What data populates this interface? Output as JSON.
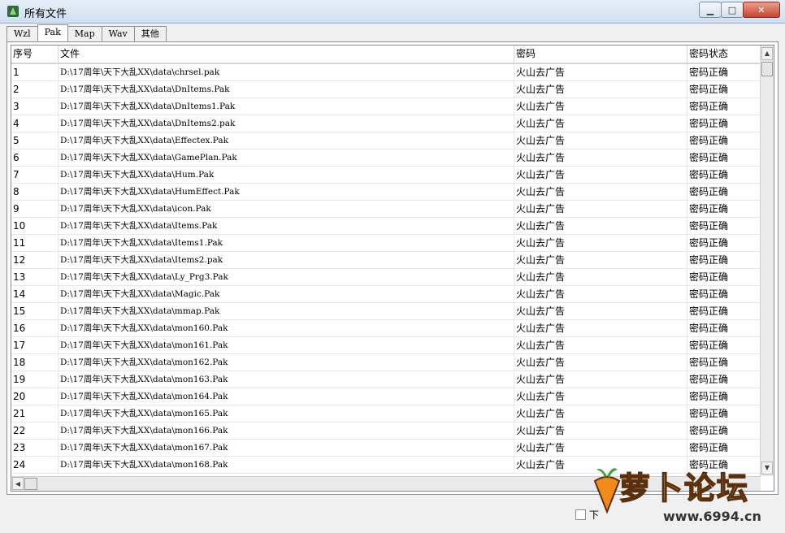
{
  "window": {
    "title": "所有文件"
  },
  "tabs": [
    {
      "label": "Wzl"
    },
    {
      "label": "Pak"
    },
    {
      "label": "Map"
    },
    {
      "label": "Wav"
    },
    {
      "label": "其他"
    }
  ],
  "columns": [
    "序号",
    "文件",
    "密码",
    "密码状态"
  ],
  "rows": [
    {
      "n": "1",
      "file": "D:\\17周年\\天下大乱XX\\data\\chrsel.pak",
      "pw": "火山去广告",
      "status": "密码正确"
    },
    {
      "n": "2",
      "file": "D:\\17周年\\天下大乱XX\\data\\DnItems.Pak",
      "pw": "火山去广告",
      "status": "密码正确"
    },
    {
      "n": "3",
      "file": "D:\\17周年\\天下大乱XX\\data\\DnItems1.Pak",
      "pw": "火山去广告",
      "status": "密码正确"
    },
    {
      "n": "4",
      "file": "D:\\17周年\\天下大乱XX\\data\\DnItems2.pak",
      "pw": "火山去广告",
      "status": "密码正确"
    },
    {
      "n": "5",
      "file": "D:\\17周年\\天下大乱XX\\data\\Effectex.Pak",
      "pw": "火山去广告",
      "status": "密码正确"
    },
    {
      "n": "6",
      "file": "D:\\17周年\\天下大乱XX\\data\\GamePlan.Pak",
      "pw": "火山去广告",
      "status": "密码正确"
    },
    {
      "n": "7",
      "file": "D:\\17周年\\天下大乱XX\\data\\Hum.Pak",
      "pw": "火山去广告",
      "status": "密码正确"
    },
    {
      "n": "8",
      "file": "D:\\17周年\\天下大乱XX\\data\\HumEffect.Pak",
      "pw": "火山去广告",
      "status": "密码正确"
    },
    {
      "n": "9",
      "file": "D:\\17周年\\天下大乱XX\\data\\icon.Pak",
      "pw": "火山去广告",
      "status": "密码正确"
    },
    {
      "n": "10",
      "file": "D:\\17周年\\天下大乱XX\\data\\Items.Pak",
      "pw": "火山去广告",
      "status": "密码正确"
    },
    {
      "n": "11",
      "file": "D:\\17周年\\天下大乱XX\\data\\Items1.Pak",
      "pw": "火山去广告",
      "status": "密码正确"
    },
    {
      "n": "12",
      "file": "D:\\17周年\\天下大乱XX\\data\\Items2.pak",
      "pw": "火山去广告",
      "status": "密码正确"
    },
    {
      "n": "13",
      "file": "D:\\17周年\\天下大乱XX\\data\\Ly_Prg3.Pak",
      "pw": "火山去广告",
      "status": "密码正确"
    },
    {
      "n": "14",
      "file": "D:\\17周年\\天下大乱XX\\data\\Magic.Pak",
      "pw": "火山去广告",
      "status": "密码正确"
    },
    {
      "n": "15",
      "file": "D:\\17周年\\天下大乱XX\\data\\mmap.Pak",
      "pw": "火山去广告",
      "status": "密码正确"
    },
    {
      "n": "16",
      "file": "D:\\17周年\\天下大乱XX\\data\\mon160.Pak",
      "pw": "火山去广告",
      "status": "密码正确"
    },
    {
      "n": "17",
      "file": "D:\\17周年\\天下大乱XX\\data\\mon161.Pak",
      "pw": "火山去广告",
      "status": "密码正确"
    },
    {
      "n": "18",
      "file": "D:\\17周年\\天下大乱XX\\data\\mon162.Pak",
      "pw": "火山去广告",
      "status": "密码正确"
    },
    {
      "n": "19",
      "file": "D:\\17周年\\天下大乱XX\\data\\mon163.Pak",
      "pw": "火山去广告",
      "status": "密码正确"
    },
    {
      "n": "20",
      "file": "D:\\17周年\\天下大乱XX\\data\\mon164.Pak",
      "pw": "火山去广告",
      "status": "密码正确"
    },
    {
      "n": "21",
      "file": "D:\\17周年\\天下大乱XX\\data\\mon165.Pak",
      "pw": "火山去广告",
      "status": "密码正确"
    },
    {
      "n": "22",
      "file": "D:\\17周年\\天下大乱XX\\data\\mon166.Pak",
      "pw": "火山去广告",
      "status": "密码正确"
    },
    {
      "n": "23",
      "file": "D:\\17周年\\天下大乱XX\\data\\mon167.Pak",
      "pw": "火山去广告",
      "status": "密码正确"
    },
    {
      "n": "24",
      "file": "D:\\17周年\\天下大乱XX\\data\\mon168.Pak",
      "pw": "火山去广告",
      "status": "密码正确"
    }
  ],
  "footer": {
    "checkbox_label": "下"
  },
  "watermark": {
    "text": "萝卜论坛",
    "url": "www.6994.cn"
  }
}
